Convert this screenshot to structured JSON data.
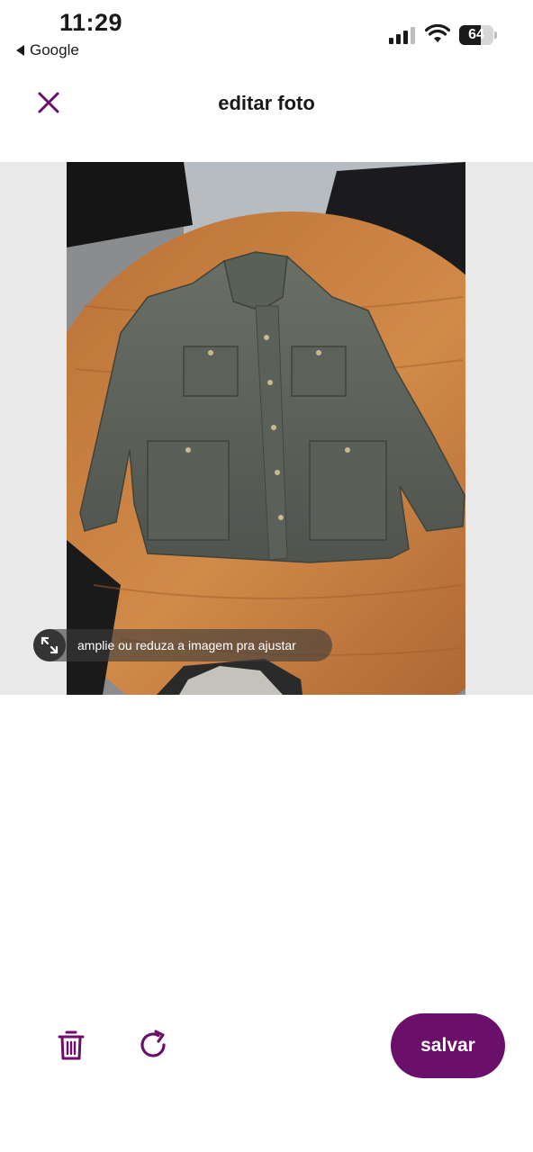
{
  "status_bar": {
    "time": "11:29",
    "back_app_label": "Google",
    "battery_percent": "64",
    "battery_level": 0.64
  },
  "header": {
    "title": "editar foto",
    "close_icon": "close-icon"
  },
  "editor": {
    "hint_text": "amplie ou reduza a imagem pra ajustar",
    "hint_icon": "resize-icon"
  },
  "toolbar": {
    "delete_icon": "trash-icon",
    "rotate_icon": "rotate-icon",
    "save_label": "salvar"
  },
  "colors": {
    "accent": "#6a0f6a",
    "hint_bg": "#3c3c3c"
  }
}
